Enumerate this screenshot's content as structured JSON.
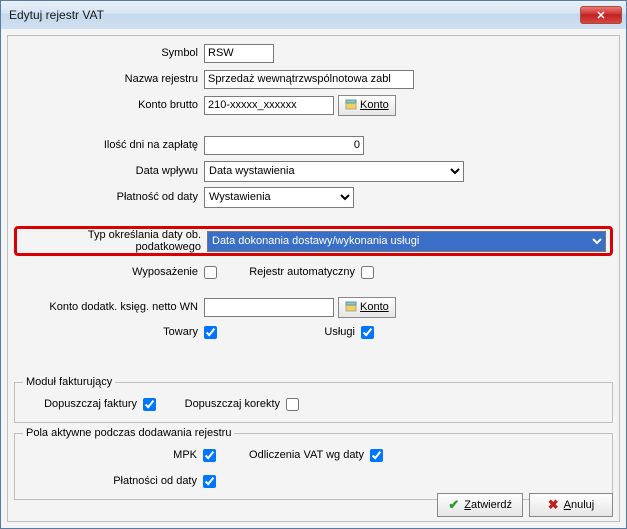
{
  "window": {
    "title": "Edytuj rejestr VAT"
  },
  "labels": {
    "symbol": "Symbol",
    "nazwa": "Nazwa rejestru",
    "konto_brutto": "Konto brutto",
    "ilosc_dni": "Ilość dni na zapłatę",
    "data_wplywu": "Data wpływu",
    "platnosc_od": "Płatność od daty",
    "typ_daty": "Typ określania daty ob. podatkowego",
    "wyposazenie": "Wyposażenie",
    "rejestr_auto": "Rejestr automatyczny",
    "konto_dodatk": "Konto dodatk. księg. netto WN",
    "towary": "Towary",
    "uslugi": "Usługi",
    "dop_faktury": "Dopuszczaj faktury",
    "dop_korekty": "Dopuszczaj korekty",
    "mpk": "MPK",
    "odlicz_vat": "Odliczenia VAT wg daty",
    "platnosci_od": "Płatności od daty"
  },
  "values": {
    "symbol": "RSW",
    "nazwa": "Sprzedaż wewnątrzwspólnotowa zabl",
    "konto_brutto": "210-xxxxx_xxxxxx",
    "ilosc_dni": "0",
    "data_wplywu": "Data wystawienia",
    "platnosc_od": "Wystawienia",
    "typ_daty": "Data dokonania dostawy/wykonania usługi",
    "konto_dodatk": ""
  },
  "checks": {
    "wyposazenie": false,
    "rejestr_auto": false,
    "towary": true,
    "uslugi": true,
    "dop_faktury": true,
    "dop_korekty": false,
    "mpk": true,
    "odlicz_vat": true,
    "platnosci_od": true
  },
  "fieldsets": {
    "modul": "Moduł fakturujący",
    "pola": "Pola aktywne podczas dodawania rejestru"
  },
  "buttons": {
    "konto": "Konto",
    "zatwierdz": "Zatwierdź",
    "anuluj": "Anuluj"
  }
}
